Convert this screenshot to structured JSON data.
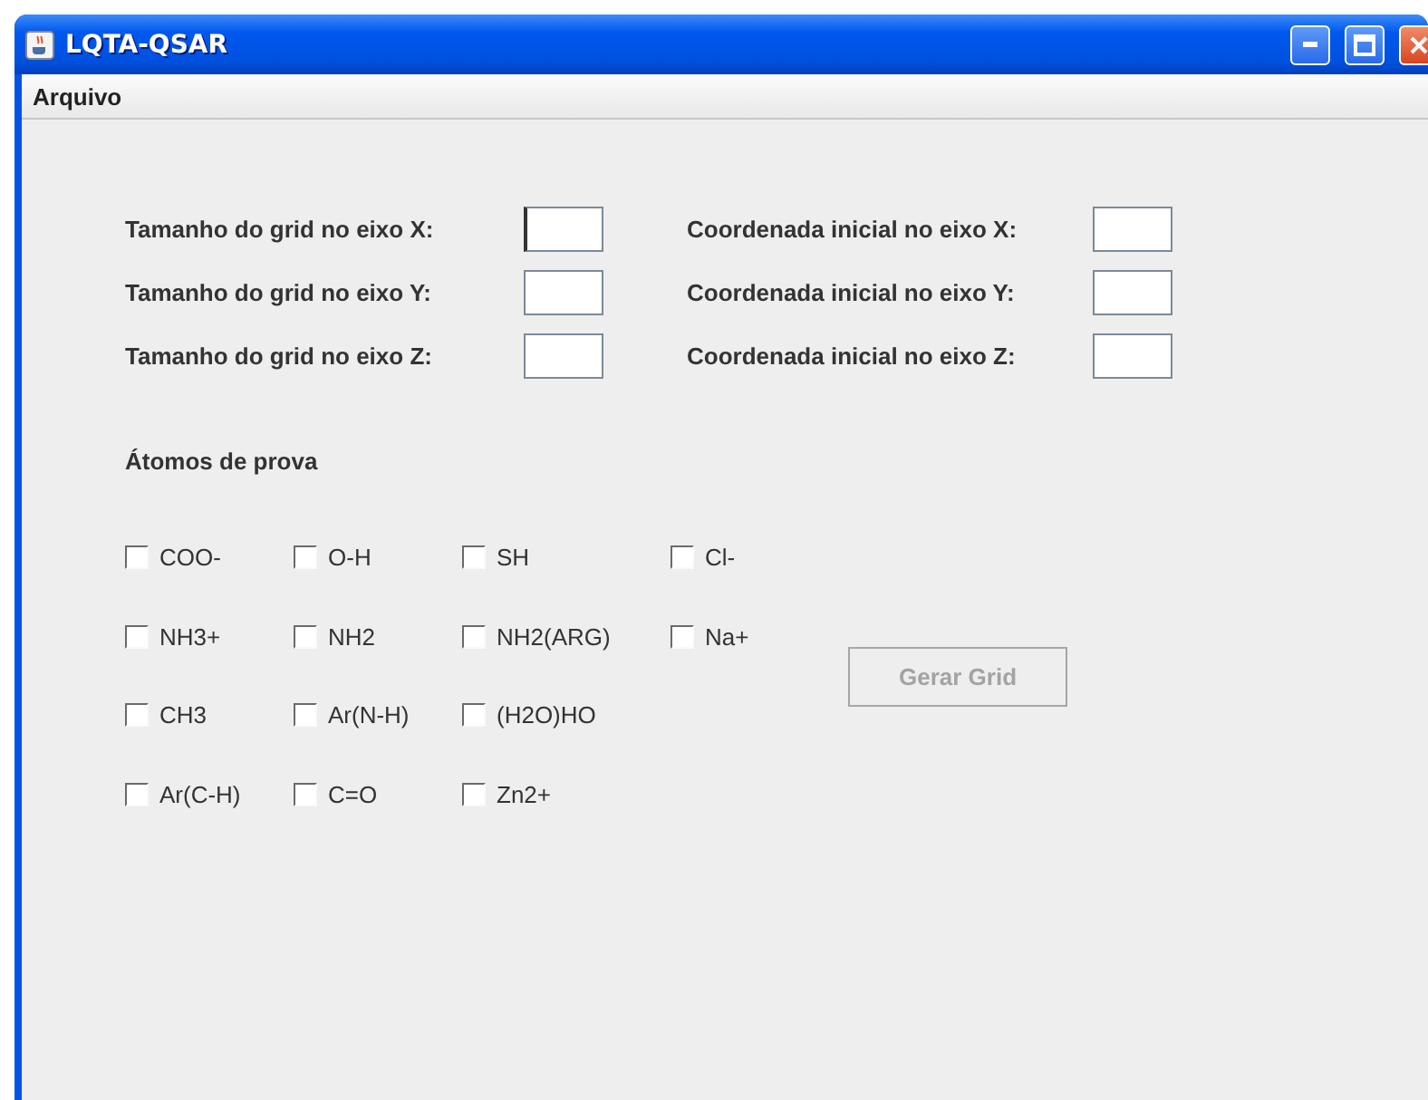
{
  "window": {
    "title": "LQTA-QSAR"
  },
  "menu": [
    {
      "label": "Arquivo"
    }
  ],
  "grid_fields": [
    {
      "label": "Tamanho do grid no eixo X:",
      "focused": true
    },
    {
      "label": "Coordenada inicial no eixo X:",
      "focused": false
    },
    {
      "label": "Tamanho do grid no eixo Y:",
      "focused": false
    },
    {
      "label": "Coordenada inicial no eixo Y:",
      "focused": false
    },
    {
      "label": "Tamanho do grid no eixo Z:",
      "focused": false
    },
    {
      "label": "Coordenada inicial no eixo Z:",
      "focused": false
    }
  ],
  "probe_atoms": {
    "title": "Átomos de prova",
    "rows": [
      [
        {
          "label": "COO-",
          "checked": false
        },
        {
          "label": "O-H",
          "checked": false
        },
        {
          "label": "SH",
          "checked": false
        },
        {
          "label": "Cl-",
          "checked": false
        }
      ],
      [
        {
          "label": "NH3+",
          "checked": false
        },
        {
          "label": "NH2",
          "checked": false
        },
        {
          "label": "NH2(ARG)",
          "checked": false
        },
        {
          "label": "Na+",
          "checked": false
        }
      ],
      [
        {
          "label": "CH3",
          "checked": false
        },
        {
          "label": "Ar(N-H)",
          "checked": false
        },
        {
          "label": "(H2O)HO",
          "checked": false
        }
      ],
      [
        {
          "label": "Ar(C-H)",
          "checked": false
        },
        {
          "label": "C=O",
          "checked": false
        },
        {
          "label": "Zn2+",
          "checked": false
        }
      ]
    ]
  },
  "generate_button": {
    "label": "Gerar Grid",
    "disabled": true
  }
}
